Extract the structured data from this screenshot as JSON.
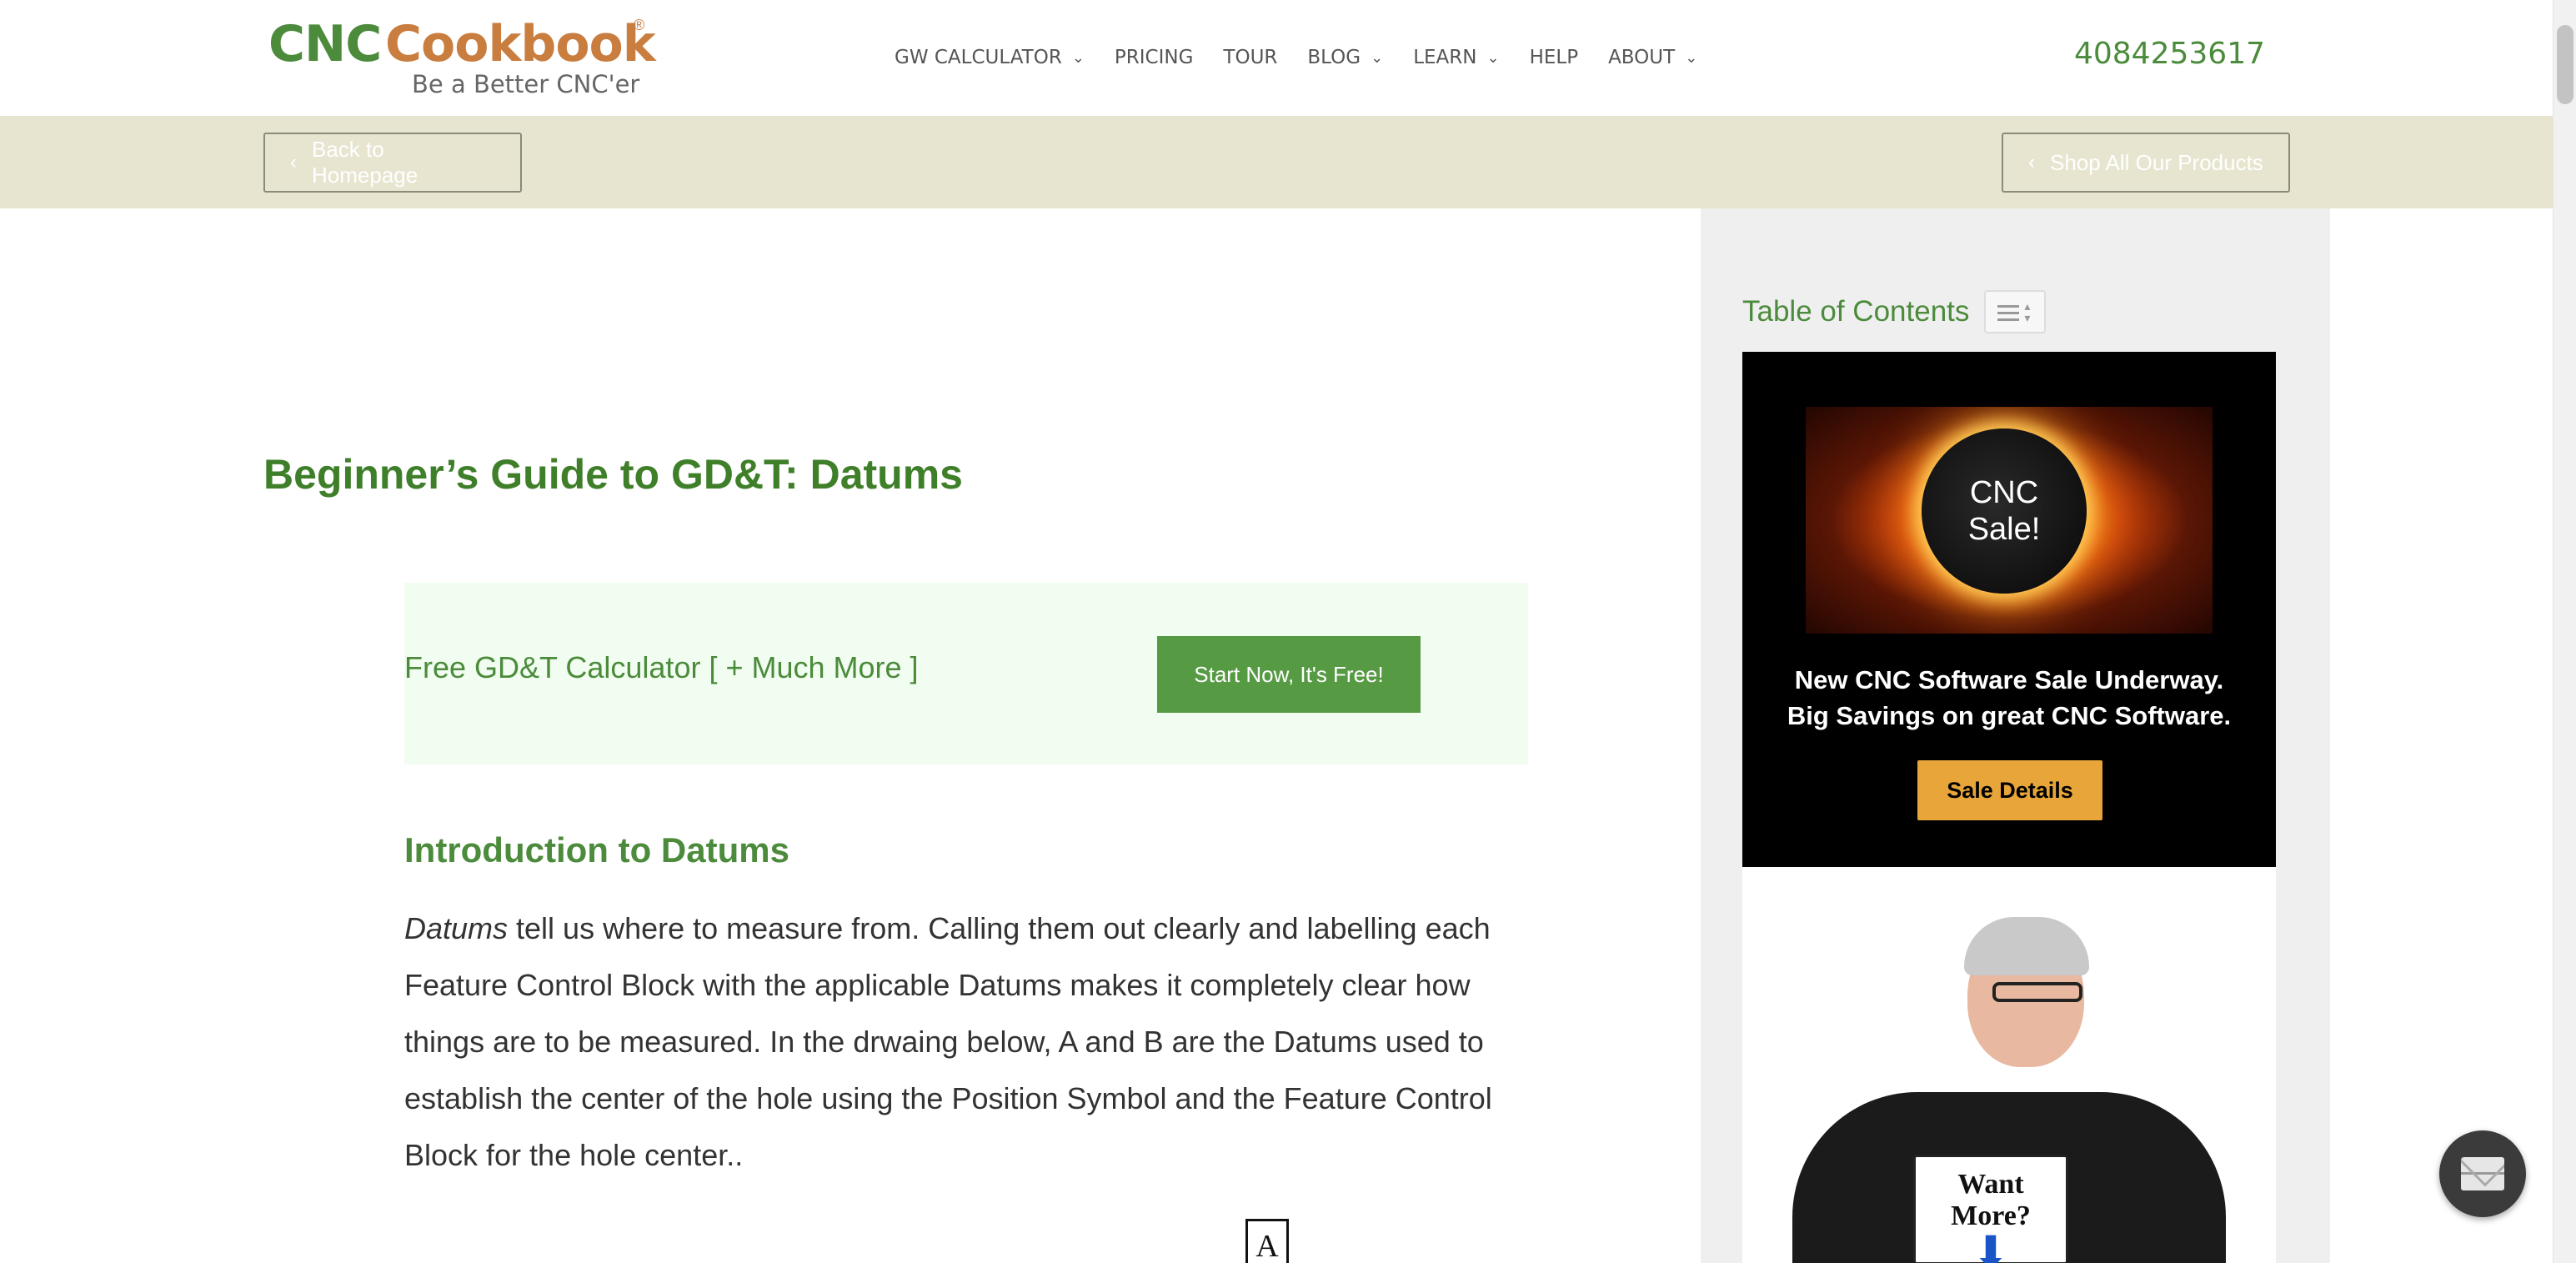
{
  "header": {
    "logo": {
      "word1": "CNC",
      "word2": "Cookbook",
      "registered": "®",
      "tagline": "Be a Better CNC'er"
    },
    "nav": [
      {
        "label": "GW CALCULATOR",
        "dropdown": true
      },
      {
        "label": "PRICING",
        "dropdown": false
      },
      {
        "label": "TOUR",
        "dropdown": false
      },
      {
        "label": "BLOG",
        "dropdown": true
      },
      {
        "label": "LEARN",
        "dropdown": true
      },
      {
        "label": "HELP",
        "dropdown": false
      },
      {
        "label": "ABOUT",
        "dropdown": true
      }
    ],
    "phone": "4084253617"
  },
  "subbar": {
    "back_label": "Back to Homepage",
    "shop_label": "Shop All Our Products"
  },
  "main": {
    "title": "Beginner’s Guide to GD&T: Datums",
    "cta": {
      "text": "Free GD&T Calculator [ + Much More ]",
      "button": "Start Now, It's Free!"
    },
    "section_heading": "Introduction to Datums",
    "paragraph": {
      "lead_italic": "Datums",
      "rest": " tell us where to measure from. Calling them out clearly and labelling each Feature Control Block with the applicable Datums makes it completely clear how things are to be measured. In the drwaing below, A and B are the Datums used to establish the center of the hole using the Position Symbol and the Feature Control Block for the hole center.."
    },
    "diagram_datum_label": "A"
  },
  "sidebar": {
    "toc_title": "Table of Contents",
    "ad": {
      "image_text_line1": "CNC",
      "image_text_line2": "Sale!",
      "headline_line1": "New CNC Software Sale Underway.",
      "headline_line2": "Big Savings on great CNC Software.",
      "button": "Sale Details"
    },
    "promo": {
      "sign_text": "Want More?"
    }
  },
  "colors": {
    "brand_green": "#4b8b3b",
    "brand_orange": "#c97d3e",
    "subbar_bg": "#e7e5cf",
    "cta_bg": "#f1fdf0",
    "cta_button": "#569a43",
    "ad_button": "#e8a53a"
  }
}
